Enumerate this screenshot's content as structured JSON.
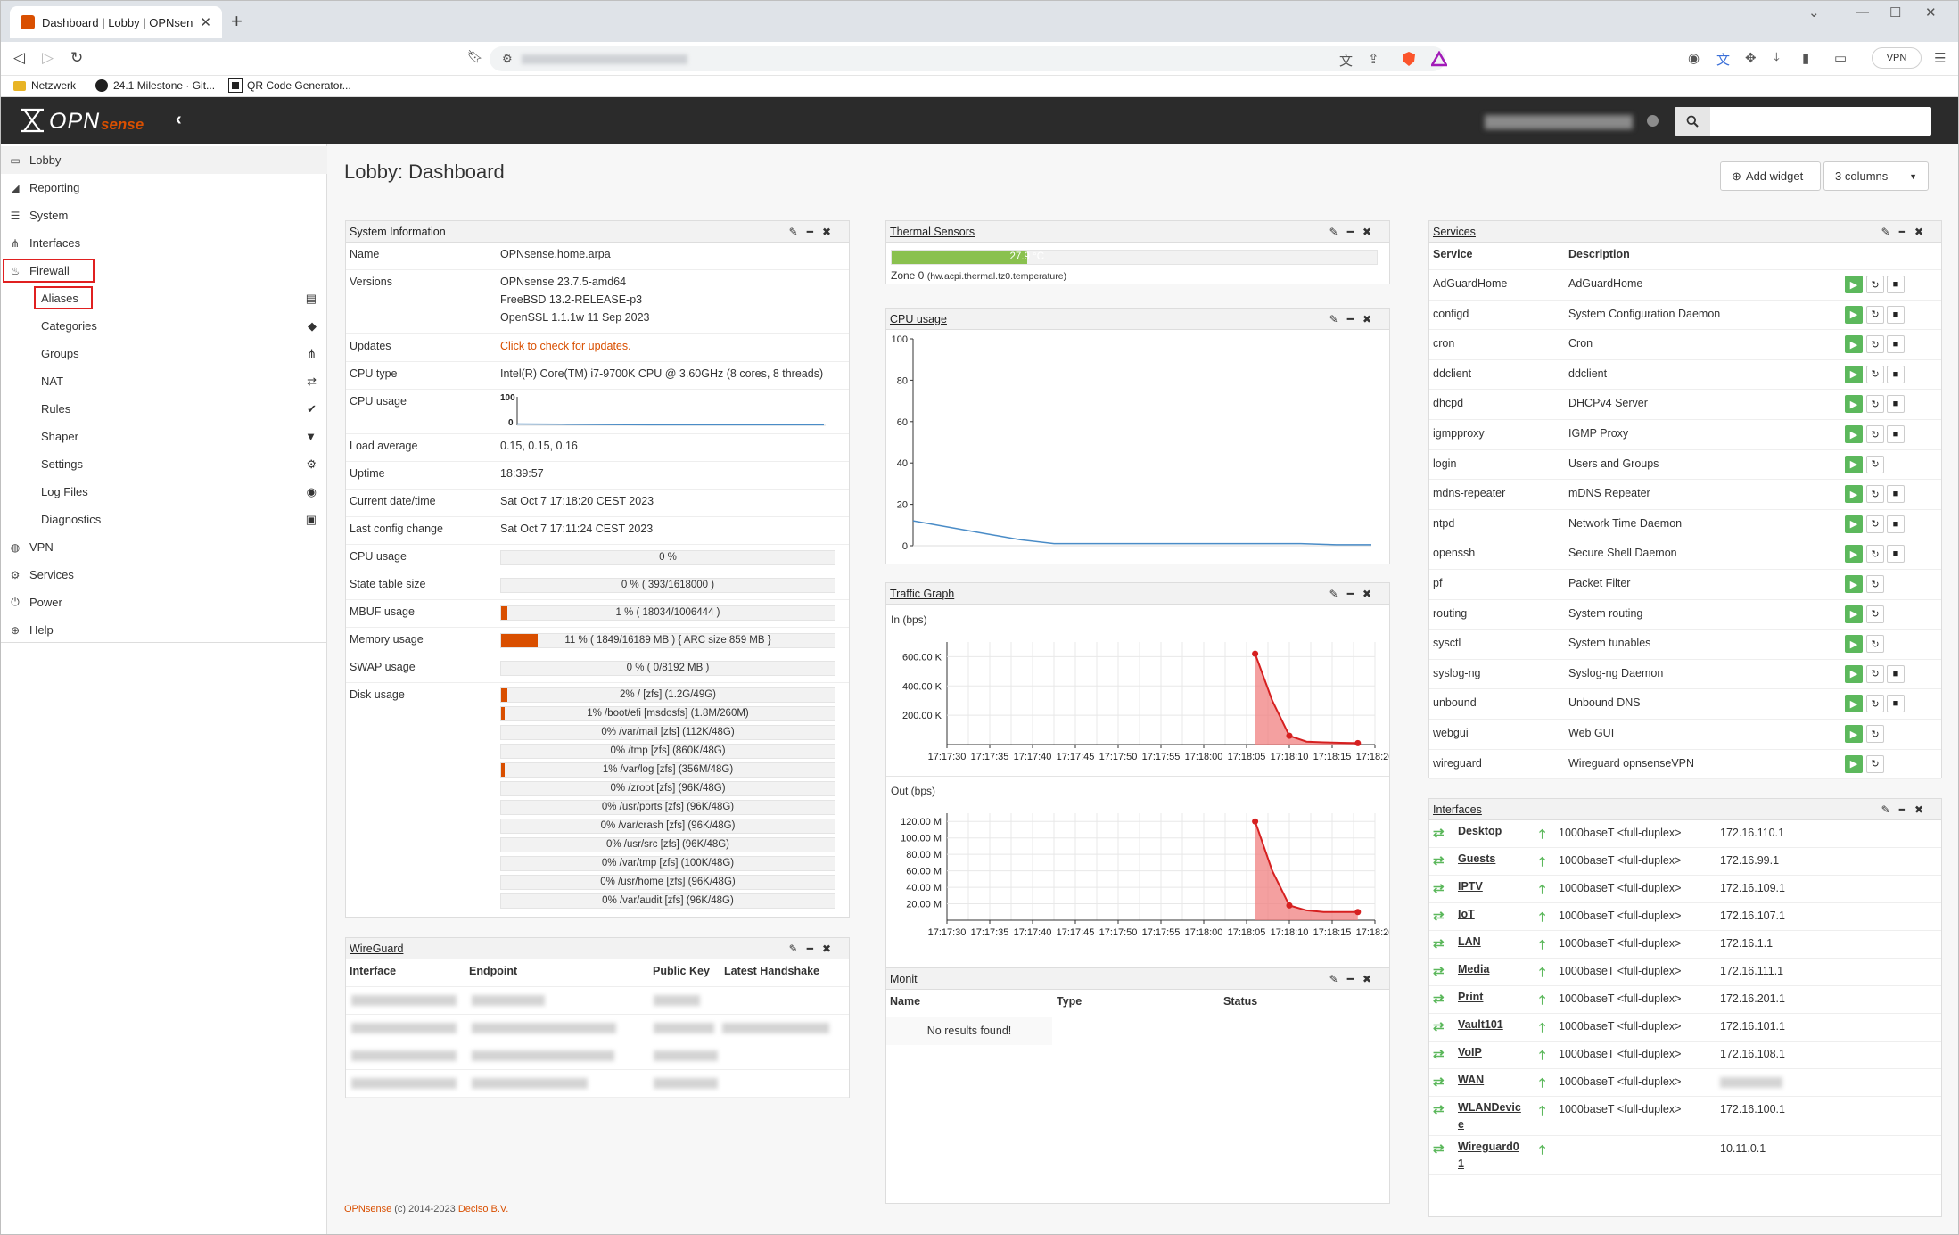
{
  "browser": {
    "tab_title": "Dashboard | Lobby | OPNsense.h",
    "vpn_label": "VPN",
    "bookmarks": [
      "Netzwerk",
      "24.1 Milestone · Git...",
      "QR Code Generator..."
    ]
  },
  "header": {
    "logo_text": "OPNsense",
    "search_placeholder": ""
  },
  "sidebar": {
    "items": [
      {
        "label": "Lobby",
        "icon": "laptop-icon"
      },
      {
        "label": "Reporting",
        "icon": "area-chart-icon"
      },
      {
        "label": "System",
        "icon": "server-icon"
      },
      {
        "label": "Interfaces",
        "icon": "sitemap-icon"
      },
      {
        "label": "Firewall",
        "icon": "fire-icon"
      }
    ],
    "firewall_sub": [
      {
        "label": "Aliases",
        "icon": "list-alt-icon"
      },
      {
        "label": "Categories",
        "icon": "tags-icon"
      },
      {
        "label": "Groups",
        "icon": "sitemap-icon"
      },
      {
        "label": "NAT",
        "icon": "exchange-icon"
      },
      {
        "label": "Rules",
        "icon": "check-icon"
      },
      {
        "label": "Shaper",
        "icon": "filter-icon"
      },
      {
        "label": "Settings",
        "icon": "cogs-icon"
      },
      {
        "label": "Log Files",
        "icon": "eye-icon"
      },
      {
        "label": "Diagnostics",
        "icon": "medkit-icon"
      }
    ],
    "items_after": [
      {
        "label": "VPN",
        "icon": "globe-icon"
      },
      {
        "label": "Services",
        "icon": "cog-icon"
      },
      {
        "label": "Power",
        "icon": "plug-icon"
      },
      {
        "label": "Help",
        "icon": "life-ring-icon"
      }
    ]
  },
  "page": {
    "title": "Lobby: Dashboard",
    "add_widget": "Add widget",
    "columns": "3 columns"
  },
  "sysinfo": {
    "title": "System Information",
    "name_label": "Name",
    "name": "OPNsense.home.arpa",
    "versions_label": "Versions",
    "versions": [
      "OPNsense 23.7.5-amd64",
      "FreeBSD 13.2-RELEASE-p3",
      "OpenSSL 1.1.1w 11 Sep 2023"
    ],
    "updates_label": "Updates",
    "updates": "Click to check for updates.",
    "cpu_type_label": "CPU type",
    "cpu_type": "Intel(R) Core(TM) i7-9700K CPU @ 3.60GHz (8 cores, 8 threads)",
    "cpu_usage_label": "CPU usage",
    "cpu_graph": {
      "ymax_label": "100",
      "ymin_label": "0",
      "values": [
        5,
        4,
        3,
        2,
        2,
        2,
        2,
        2
      ]
    },
    "load_label": "Load average",
    "load": "0.15, 0.15, 0.16",
    "uptime_label": "Uptime",
    "uptime": "18:39:57",
    "datetime_label": "Current date/time",
    "datetime": "Sat Oct 7 17:18:20 CEST 2023",
    "lastconfig_label": "Last config change",
    "lastconfig": "Sat Oct 7 17:11:24 CEST 2023",
    "cpu_usage2_label": "CPU usage",
    "cpu_usage2": "0 %",
    "bars": [
      {
        "label": "State table size",
        "text": "0 % ( 393/1618000 )",
        "pct": 0.02
      },
      {
        "label": "MBUF usage",
        "text": "1 % ( 18034/1006444 )",
        "pct": 1.8
      },
      {
        "label": "Memory usage",
        "text": "11 % ( 1849/16189 MB ) { ARC size 859 MB }",
        "pct": 11
      },
      {
        "label": "SWAP usage",
        "text": "0 % ( 0/8192 MB )",
        "pct": 0
      }
    ],
    "disk_label": "Disk usage",
    "disks": [
      {
        "text": "2% / [zfs] (1.2G/49G)",
        "pct": 2
      },
      {
        "text": "1% /boot/efi [msdosfs] (1.8M/260M)",
        "pct": 1
      },
      {
        "text": "0% /var/mail [zfs] (112K/48G)",
        "pct": 0
      },
      {
        "text": "0% /tmp [zfs] (860K/48G)",
        "pct": 0
      },
      {
        "text": "1% /var/log [zfs] (356M/48G)",
        "pct": 1
      },
      {
        "text": "0% /zroot [zfs] (96K/48G)",
        "pct": 0
      },
      {
        "text": "0% /usr/ports [zfs] (96K/48G)",
        "pct": 0
      },
      {
        "text": "0% /var/crash [zfs] (96K/48G)",
        "pct": 0
      },
      {
        "text": "0% /usr/src [zfs] (96K/48G)",
        "pct": 0
      },
      {
        "text": "0% /var/tmp [zfs] (100K/48G)",
        "pct": 0
      },
      {
        "text": "0% /usr/home [zfs] (96K/48G)",
        "pct": 0
      },
      {
        "text": "0% /var/audit [zfs] (96K/48G)",
        "pct": 0
      }
    ]
  },
  "wireguard": {
    "title": "WireGuard",
    "cols": [
      "Interface",
      "Endpoint",
      "Public Key",
      "Latest Handshake"
    ]
  },
  "thermal": {
    "title": "Thermal Sensors",
    "value": "27.9 °C",
    "pct": 27.9,
    "sensor": "Zone 0",
    "sensor_key": "(hw.acpi.thermal.tz0.temperature)"
  },
  "cpu": {
    "title": "CPU usage",
    "y_ticks": [
      "100",
      "80",
      "60",
      "40",
      "20",
      "0"
    ],
    "values": [
      12,
      9,
      6,
      3,
      1,
      1,
      1,
      1,
      1,
      1,
      1,
      1,
      0.5,
      0.5
    ]
  },
  "traffic": {
    "title": "Traffic Graph",
    "in_label": "In (bps)",
    "out_label": "Out (bps)",
    "in_ticks": [
      "600.00 K",
      "400.00 K",
      "200.00 K"
    ],
    "out_ticks": [
      "120.00 M",
      "100.00 M",
      "80.00 M",
      "60.00 M",
      "40.00 M",
      "20.00 M"
    ],
    "x_ticks": [
      "17:17:30",
      "17:17:35",
      "17:17:40",
      "17:17:45",
      "17:17:50",
      "17:17:55",
      "17:18:00",
      "17:18:05",
      "17:18:10",
      "17:18:15",
      "17:18:20"
    ]
  },
  "chart_data": [
    {
      "type": "area",
      "title": "In (bps)",
      "x": [
        "17:18:06",
        "17:18:08",
        "17:18:10",
        "17:18:12",
        "17:18:14",
        "17:18:16",
        "17:18:18"
      ],
      "series": [
        {
          "values": [
            620000,
            300000,
            60000,
            20000,
            15000,
            12000,
            10000
          ]
        }
      ],
      "ylim": [
        0,
        700000
      ]
    },
    {
      "type": "area",
      "title": "Out (bps)",
      "x": [
        "17:18:06",
        "17:18:08",
        "17:18:10",
        "17:18:12",
        "17:18:14",
        "17:18:16",
        "17:18:18"
      ],
      "series": [
        {
          "values": [
            120000000,
            60000000,
            18000000,
            12000000,
            10000000,
            10000000,
            10000000
          ]
        }
      ],
      "ylim": [
        0,
        130000000
      ]
    }
  ],
  "monit": {
    "title": "Monit",
    "cols": [
      "Name",
      "Type",
      "Status"
    ],
    "empty": "No results found!"
  },
  "services": {
    "title": "Services",
    "cols": [
      "Service",
      "Description"
    ],
    "rows": [
      {
        "name": "AdGuardHome",
        "desc": "AdGuardHome",
        "stop": true
      },
      {
        "name": "configd",
        "desc": "System Configuration Daemon",
        "stop": true
      },
      {
        "name": "cron",
        "desc": "Cron",
        "stop": true
      },
      {
        "name": "ddclient",
        "desc": "ddclient",
        "stop": true
      },
      {
        "name": "dhcpd",
        "desc": "DHCPv4 Server",
        "stop": true
      },
      {
        "name": "igmpproxy",
        "desc": "IGMP Proxy",
        "stop": true
      },
      {
        "name": "login",
        "desc": "Users and Groups",
        "stop": false
      },
      {
        "name": "mdns-repeater",
        "desc": "mDNS Repeater",
        "stop": true
      },
      {
        "name": "ntpd",
        "desc": "Network Time Daemon",
        "stop": true
      },
      {
        "name": "openssh",
        "desc": "Secure Shell Daemon",
        "stop": true
      },
      {
        "name": "pf",
        "desc": "Packet Filter",
        "stop": false
      },
      {
        "name": "routing",
        "desc": "System routing",
        "stop": false
      },
      {
        "name": "sysctl",
        "desc": "System tunables",
        "stop": false
      },
      {
        "name": "syslog-ng",
        "desc": "Syslog-ng Daemon",
        "stop": true
      },
      {
        "name": "unbound",
        "desc": "Unbound DNS",
        "stop": true
      },
      {
        "name": "webgui",
        "desc": "Web GUI",
        "stop": false
      },
      {
        "name": "wireguard",
        "desc": "Wireguard opnsenseVPN",
        "stop": false
      }
    ]
  },
  "interfaces": {
    "title": "Interfaces",
    "rows": [
      {
        "name": "Desktop",
        "media": "1000baseT <full-duplex>",
        "ip": "172.16.110.1"
      },
      {
        "name": "Guests",
        "media": "1000baseT <full-duplex>",
        "ip": "172.16.99.1"
      },
      {
        "name": "IPTV",
        "media": "1000baseT <full-duplex>",
        "ip": "172.16.109.1"
      },
      {
        "name": "IoT",
        "media": "1000baseT <full-duplex>",
        "ip": "172.16.107.1"
      },
      {
        "name": "LAN",
        "media": "1000baseT <full-duplex>",
        "ip": "172.16.1.1"
      },
      {
        "name": "Media",
        "media": "1000baseT <full-duplex>",
        "ip": "172.16.111.1"
      },
      {
        "name": "Print",
        "media": "1000baseT <full-duplex>",
        "ip": "172.16.201.1"
      },
      {
        "name": "Vault101",
        "media": "1000baseT <full-duplex>",
        "ip": "172.16.101.1"
      },
      {
        "name": "VoIP",
        "media": "1000baseT <full-duplex>",
        "ip": "172.16.108.1"
      },
      {
        "name": "WAN",
        "media": "1000baseT <full-duplex>",
        "ip": ""
      },
      {
        "name": "WLANDevic\ne",
        "media": "1000baseT <full-duplex>",
        "ip": "172.16.100.1"
      },
      {
        "name": "Wireguard0\n1",
        "media": "",
        "ip": "10.11.0.1"
      }
    ]
  },
  "footer": {
    "brand": "OPNsense",
    "copy": " (c) 2014-2023 ",
    "company": "Deciso B.V."
  }
}
